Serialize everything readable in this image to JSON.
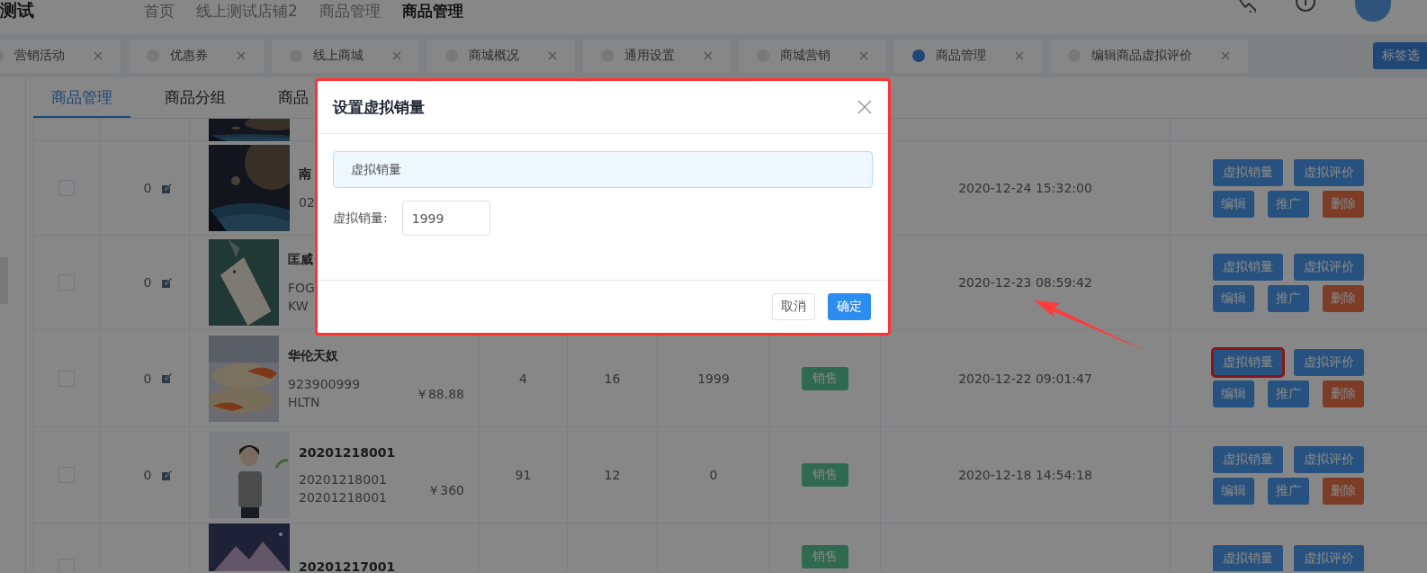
{
  "header": {
    "logo": "测试",
    "breadcrumb": [
      {
        "label": "首页",
        "current": false
      },
      {
        "label": "线上测试店铺2",
        "current": false
      },
      {
        "label": "商品管理",
        "current": false
      },
      {
        "label": "商品管理",
        "current": true
      }
    ]
  },
  "tabs": [
    {
      "label": "营销活动",
      "selected": false
    },
    {
      "label": "优惠券",
      "selected": false
    },
    {
      "label": "线上商城",
      "selected": false
    },
    {
      "label": "商城概况",
      "selected": false
    },
    {
      "label": "通用设置",
      "selected": false
    },
    {
      "label": "商城营销",
      "selected": false
    },
    {
      "label": "商品管理",
      "selected": true
    },
    {
      "label": "编辑商品虚拟评价",
      "selected": false
    }
  ],
  "tab_options_button": "标签选",
  "subtabs": [
    {
      "label": "商品管理",
      "selected": true
    },
    {
      "label": "商品分组",
      "selected": false
    },
    {
      "label": "商品",
      "selected": false
    }
  ],
  "rows": [
    {
      "checked": false,
      "sort": "0",
      "name": "南",
      "codes": [
        "02"
      ],
      "price": "",
      "stock": "",
      "sales": "",
      "virtual_sales": "",
      "status": "",
      "date": "2020-12-24 15:32:00",
      "actions": [
        {
          "label": "虚拟销量",
          "kind": "primary",
          "highlighted": false
        },
        {
          "label": "虚拟评价",
          "kind": "primary",
          "highlighted": false
        },
        {
          "label": "编辑",
          "kind": "primary",
          "highlighted": false
        },
        {
          "label": "推广",
          "kind": "primary",
          "highlighted": false
        },
        {
          "label": "删除",
          "kind": "danger",
          "highlighted": false
        }
      ]
    },
    {
      "checked": false,
      "sort": "0",
      "name": "匡威",
      "codes": [
        "FOG",
        "KW"
      ],
      "price": "",
      "stock": "",
      "sales": "",
      "virtual_sales": "",
      "status": "",
      "date": "2020-12-23 08:59:42",
      "actions": [
        {
          "label": "虚拟销量",
          "kind": "primary",
          "highlighted": false
        },
        {
          "label": "虚拟评价",
          "kind": "primary",
          "highlighted": false
        },
        {
          "label": "编辑",
          "kind": "primary",
          "highlighted": false
        },
        {
          "label": "推广",
          "kind": "primary",
          "highlighted": false
        },
        {
          "label": "删除",
          "kind": "danger",
          "highlighted": false
        }
      ]
    },
    {
      "checked": false,
      "sort": "0",
      "name": "华伦天奴",
      "codes": [
        "923900999",
        "HLTN"
      ],
      "price": "￥88.88",
      "stock": "4",
      "sales": "16",
      "virtual_sales": "1999",
      "status": "销售",
      "date": "2020-12-22 09:01:47",
      "actions": [
        {
          "label": "虚拟销量",
          "kind": "primary",
          "highlighted": true
        },
        {
          "label": "虚拟评价",
          "kind": "primary",
          "highlighted": false
        },
        {
          "label": "编辑",
          "kind": "primary",
          "highlighted": false
        },
        {
          "label": "推广",
          "kind": "primary",
          "highlighted": false
        },
        {
          "label": "删除",
          "kind": "danger",
          "highlighted": false
        }
      ]
    },
    {
      "checked": false,
      "sort": "0",
      "name": "20201218001",
      "codes": [
        "20201218001",
        "20201218001"
      ],
      "price": "￥360",
      "stock": "91",
      "sales": "12",
      "virtual_sales": "0",
      "status": "销售",
      "date": "2020-12-18 14:54:18",
      "actions": [
        {
          "label": "虚拟销量",
          "kind": "primary",
          "highlighted": false
        },
        {
          "label": "虚拟评价",
          "kind": "primary",
          "highlighted": false
        },
        {
          "label": "编辑",
          "kind": "primary",
          "highlighted": false
        },
        {
          "label": "推广",
          "kind": "primary",
          "highlighted": false
        },
        {
          "label": "删除",
          "kind": "danger",
          "highlighted": false
        }
      ]
    },
    {
      "checked": false,
      "sort": "",
      "name": "20201217001",
      "codes": [],
      "price": "",
      "stock": "",
      "sales": "",
      "virtual_sales": "",
      "status": "销售",
      "date": "",
      "actions": [
        {
          "label": "虚拟销量",
          "kind": "primary",
          "highlighted": false
        },
        {
          "label": "虚拟评价",
          "kind": "primary",
          "highlighted": false
        }
      ]
    }
  ],
  "modal": {
    "title": "设置虚拟销量",
    "highlighted": true,
    "alert": "虚拟销量",
    "field_label": "虚拟销量:",
    "field_value": "1999",
    "buttons": [
      {
        "label": "取消",
        "kind": "default"
      },
      {
        "label": "确定",
        "kind": "primary"
      }
    ]
  }
}
